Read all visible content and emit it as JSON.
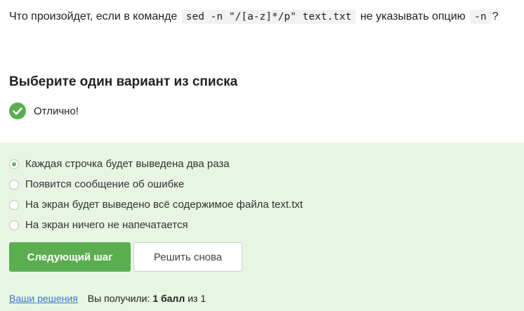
{
  "question": {
    "text_before": "Что произойдет, если в команде",
    "code_command": "sed -n \"/[a-z]*/p\" text.txt",
    "text_middle": "не указывать опцию",
    "code_option": "-n",
    "text_after": "?"
  },
  "task_heading": "Выберите один вариант из списка",
  "feedback": {
    "icon": "check-circle-icon",
    "text": "Отлично!",
    "color": "#5aae4f"
  },
  "panel_color": "#e8f5e3",
  "options": [
    {
      "label": "Каждая строчка будет выведена два раза",
      "selected": true
    },
    {
      "label": "Появится сообщение об ошибке",
      "selected": false
    },
    {
      "label": "На экран будет выведено всё содержимое файла text.txt",
      "selected": false
    },
    {
      "label": "На экран ничего не напечатается",
      "selected": false
    }
  ],
  "buttons": {
    "next_label": "Следующий шаг",
    "retry_label": "Решить снова"
  },
  "footer": {
    "solutions_link": "Ваши решения",
    "score_label": "Вы получили:",
    "score_value": "1 балл",
    "score_suffix": "из 1"
  }
}
